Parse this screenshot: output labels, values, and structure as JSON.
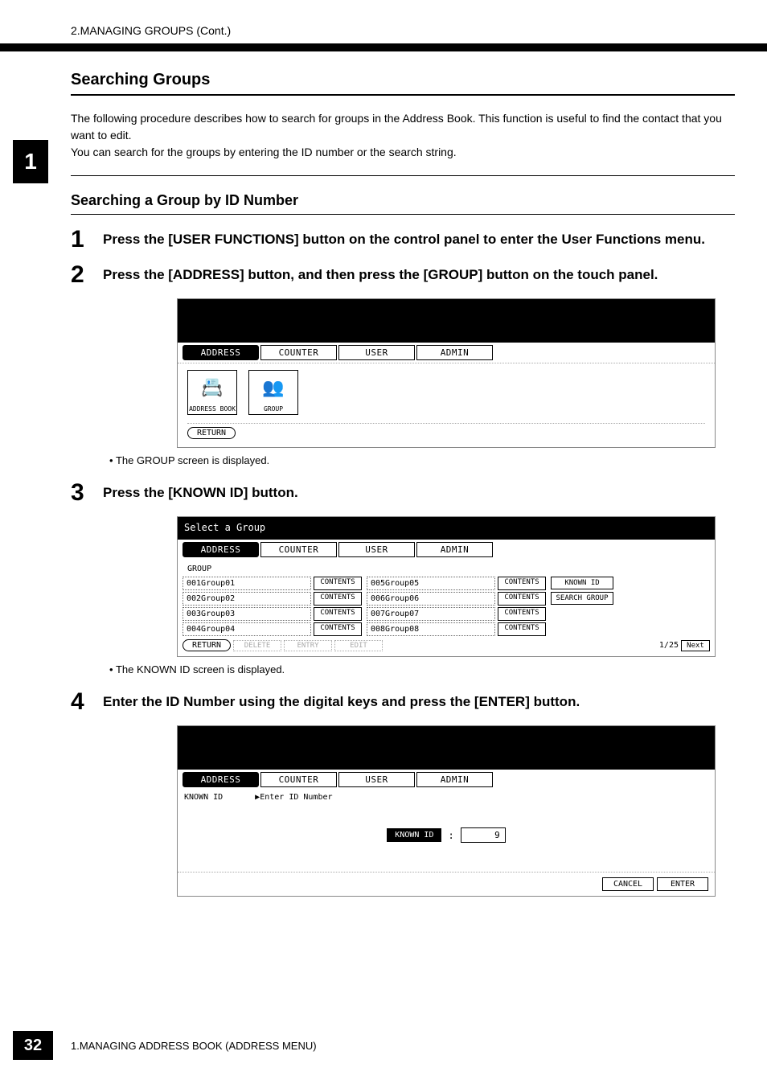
{
  "header": "2.MANAGING GROUPS (Cont.)",
  "sideTab": "1",
  "section": {
    "title": "Searching Groups",
    "intro": "The following procedure describes how to search for groups in the Address Book.  This function is useful to find the contact that you want to edit.\nYou can search for the groups by entering the ID number or the search string."
  },
  "subsection": {
    "title": "Searching a Group by ID Number",
    "steps": {
      "s1": {
        "num": "1",
        "text": "Press the [USER FUNCTIONS] button on the control panel to enter the User Functions menu."
      },
      "s2": {
        "num": "2",
        "text": "Press the [ADDRESS] button, and then press the [GROUP] button on the touch panel.",
        "bullet": "The GROUP screen is displayed."
      },
      "s3": {
        "num": "3",
        "text": "Press the [KNOWN ID] button.",
        "bullet": "The KNOWN ID screen is displayed."
      },
      "s4": {
        "num": "4",
        "text": "Enter the ID Number using the digital keys and press the [ENTER] button."
      }
    }
  },
  "fig1": {
    "tabs": [
      "ADDRESS",
      "COUNTER",
      "USER",
      "ADMIN"
    ],
    "icons": {
      "addressBook": "ADDRESS BOOK",
      "group": "GROUP"
    },
    "return": "RETURN"
  },
  "fig2": {
    "title": "Select a Group",
    "tabs": [
      "ADDRESS",
      "COUNTER",
      "USER",
      "ADMIN"
    ],
    "groupLabel": "GROUP",
    "rowsLeft": [
      "001Group01",
      "002Group02",
      "003Group03",
      "004Group04"
    ],
    "rowsRight": [
      "005Group05",
      "006Group06",
      "007Group07",
      "008Group08"
    ],
    "contents": "CONTENTS",
    "side": {
      "knownId": "KNOWN ID",
      "searchGroup": "SEARCH GROUP"
    },
    "bottom": {
      "return": "RETURN",
      "delete": "DELETE",
      "entry": "ENTRY",
      "edit": "EDIT",
      "page": "1/25",
      "next": "Next"
    }
  },
  "fig3": {
    "tabs": [
      "ADDRESS",
      "COUNTER",
      "USER",
      "ADMIN"
    ],
    "knownIdLabel": "KNOWN ID",
    "enterLabel": "▶Enter ID Number",
    "fieldLabel": "KNOWN ID",
    "fieldValue": "9",
    "cancel": "CANCEL",
    "enter": "ENTER"
  },
  "footer": {
    "pageNum": "32",
    "text": "1.MANAGING ADDRESS BOOK (ADDRESS MENU)"
  }
}
